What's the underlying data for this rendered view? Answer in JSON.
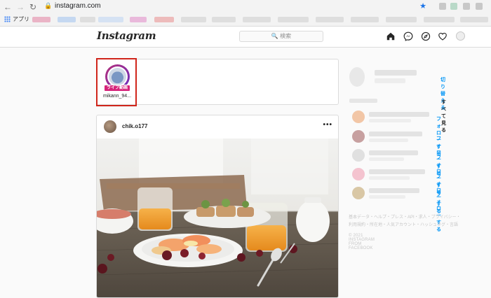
{
  "browser": {
    "url": "instagram.com",
    "apps_label": "アプリ"
  },
  "header": {
    "logo": "Instagram",
    "search_placeholder": "🔍 検索"
  },
  "stories": [
    {
      "badge": "ライブ動画",
      "username": "mikann_94..."
    }
  ],
  "post": {
    "username": "chik.o177",
    "more": "•••"
  },
  "sidebar": {
    "switch_label": "切り替える",
    "see_all_label": "すべて見る",
    "suggestions": [
      {
        "follow_label": "フォローする"
      },
      {
        "follow_label": "フォローする"
      },
      {
        "follow_label": "フォローする"
      },
      {
        "follow_label": "フォローする"
      },
      {
        "follow_label": "フォローする"
      }
    ],
    "footer_line1": "基本データ・ヘルプ・プレス・API・求人・プライバシー・",
    "footer_line2": "利用規約・所在地・人気アカウント・ハッシュタグ・言語",
    "copyright": "© 2021 INSTAGRAM FROM FACEBOOK"
  },
  "colors": {
    "highlight_box": "#d0251b",
    "link_blue": "#0095f6",
    "live_badge": "#d6237a"
  }
}
